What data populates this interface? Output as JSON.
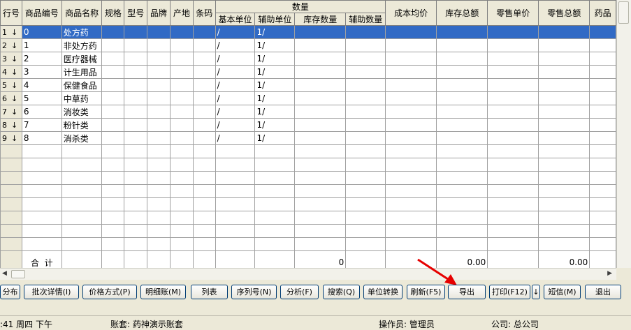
{
  "grid": {
    "headers": {
      "row_no": "行号",
      "code": "商品编号",
      "name": "商品名称",
      "spec": "规格",
      "model": "型号",
      "brand": "品牌",
      "origin": "产地",
      "barcode": "条码",
      "qty_group": "数量",
      "base_unit": "基本单位",
      "aux_unit": "辅助单位",
      "stock_qty": "库存数量",
      "aux_qty": "辅助数量",
      "cost_avg": "成本均价",
      "stock_total": "库存总额",
      "retail_price": "零售单价",
      "retail_total": "零售总额",
      "drug": "药品"
    },
    "rows": [
      {
        "no": "1",
        "code": "0",
        "name": "处方药",
        "base_unit": "/",
        "aux_unit": "1/"
      },
      {
        "no": "2",
        "code": "1",
        "name": "非处方药",
        "base_unit": "/",
        "aux_unit": "1/"
      },
      {
        "no": "3",
        "code": "2",
        "name": "医疗器械",
        "base_unit": "/",
        "aux_unit": "1/"
      },
      {
        "no": "4",
        "code": "3",
        "name": "计生用品",
        "base_unit": "/",
        "aux_unit": "1/"
      },
      {
        "no": "5",
        "code": "4",
        "name": "保健食品",
        "base_unit": "/",
        "aux_unit": "1/"
      },
      {
        "no": "6",
        "code": "5",
        "name": "中草药",
        "base_unit": "/",
        "aux_unit": "1/"
      },
      {
        "no": "7",
        "code": "6",
        "name": "消妆类",
        "base_unit": "/",
        "aux_unit": "1/"
      },
      {
        "no": "8",
        "code": "7",
        "name": "粉针类",
        "base_unit": "/",
        "aux_unit": "1/"
      },
      {
        "no": "9",
        "code": "8",
        "name": "消杀类",
        "base_unit": "/",
        "aux_unit": "1/"
      }
    ],
    "row_arrow": "↓",
    "total": {
      "label": "合  计",
      "stock_qty": "0",
      "stock_total": "0.00",
      "retail_total": "0.00"
    }
  },
  "buttons": {
    "distribution": "分布",
    "batch_detail": "批次详情(I)",
    "price_method": "价格方式(P)",
    "detail_ledger": "明细账(M)",
    "list": "列表",
    "serial": "序列号(N)",
    "analyze": "分析(F)",
    "search": "搜索(Q)",
    "unit_convert": "单位转换",
    "refresh": "刷新(F5)",
    "export": "导出",
    "print": "打印(F12)",
    "print_more": "↓",
    "sms": "短信(M)",
    "exit": "退出"
  },
  "status": {
    "time": ":41 周四 下午",
    "account": "账套: 药神演示账套",
    "operator": "操作员: 管理员",
    "company": "公司: 总公司"
  },
  "colors": {
    "selection": "#316ac5",
    "annotation_arrow": "#e60000"
  }
}
